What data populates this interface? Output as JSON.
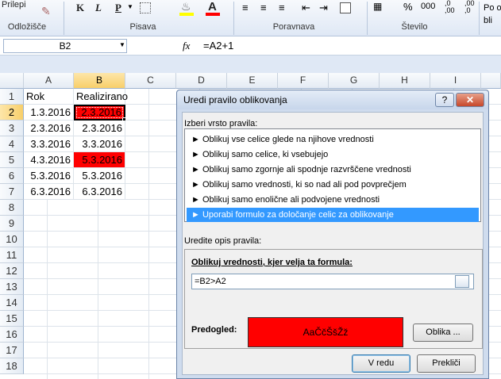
{
  "ribbon": {
    "paste_label": "Prilepi",
    "clipboard_group": "Odložišče",
    "font_group": "Pisava",
    "alignment_group": "Poravnava",
    "number_group": "Število",
    "styles_partial": "Po obli",
    "bold": "K",
    "underline": "P",
    "percent": "%",
    "thousands": "000",
    "font_color_letter": "A"
  },
  "formula_bar": {
    "name_box": "B2",
    "fx": "fx",
    "formula": "=A2+1"
  },
  "sheet": {
    "columns": [
      "A",
      "B",
      "C",
      "D",
      "E",
      "F",
      "G",
      "H",
      "I"
    ],
    "rows": [
      "1",
      "2",
      "3",
      "4",
      "5",
      "6",
      "7",
      "8",
      "9",
      "10",
      "11",
      "12",
      "13",
      "14",
      "15",
      "16",
      "17",
      "18"
    ],
    "headers": {
      "a1": "Rok",
      "b1": "Realizirano"
    },
    "data": [
      {
        "a": "1.3.2016",
        "b": "2.3.2016",
        "highlight": true
      },
      {
        "a": "2.3.2016",
        "b": "2.3.2016",
        "highlight": false
      },
      {
        "a": "3.3.2016",
        "b": "3.3.2016",
        "highlight": false
      },
      {
        "a": "4.3.2016",
        "b": "5.3.2016",
        "highlight": true
      },
      {
        "a": "5.3.2016",
        "b": "5.3.2016",
        "highlight": false
      },
      {
        "a": "6.3.2016",
        "b": "6.3.2016",
        "highlight": false
      }
    ],
    "selected_cell": "B2",
    "highlight_color": "#ff0000"
  },
  "dialog": {
    "title": "Uredi pravilo oblikovanja",
    "help_button": "?",
    "close_button": "✕",
    "rule_type_label": "Izberi vrsto pravila:",
    "rule_types": [
      "► Oblikuj vse celice glede na njihove vrednosti",
      "► Oblikuj samo celice, ki vsebujejo",
      "► Oblikuj samo zgornje ali spodnje razvrščene vrednosti",
      "► Oblikuj samo vrednosti, ki so nad ali pod povprečjem",
      "► Oblikuj samo enolične ali podvojene vrednosti",
      "► Uporabi formulo za določanje celic za oblikovanje"
    ],
    "selected_rule_index": 5,
    "desc_label": "Uredite opis pravila:",
    "formula_label": "Oblikuj vrednosti, kjer velja ta formula:",
    "formula_value": "=B2>A2",
    "preview_label": "Predogled:",
    "preview_text": "AaČčŠšŽž",
    "format_button": "Oblika ...",
    "ok_button": "V redu",
    "cancel_button": "Prekliči"
  }
}
